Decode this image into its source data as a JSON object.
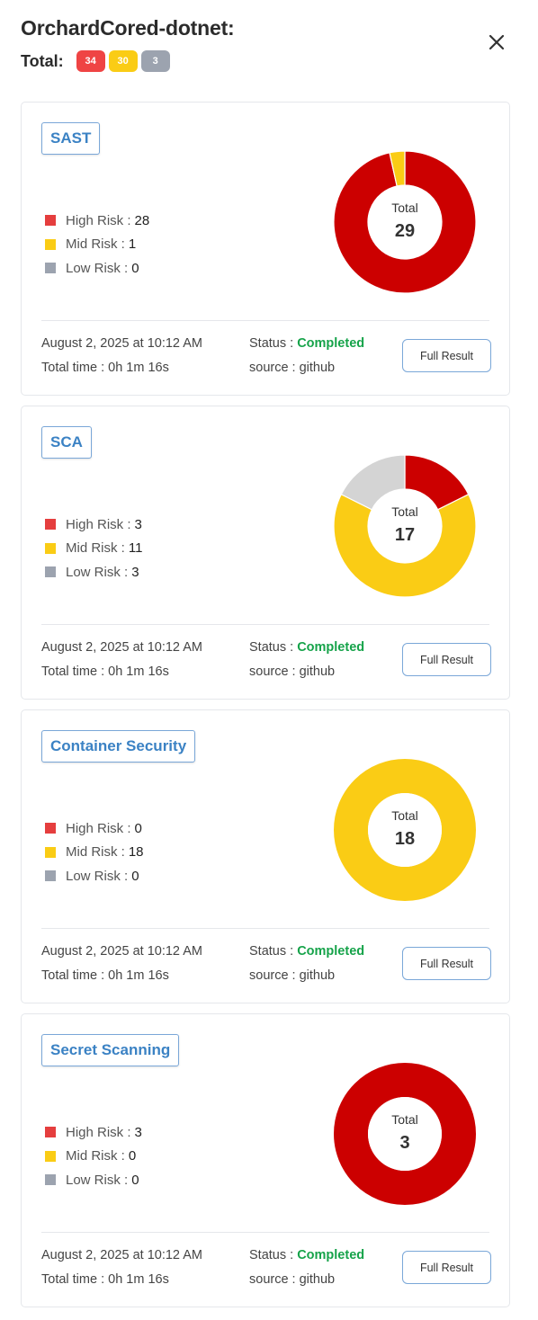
{
  "header": {
    "title": "OrchardCored-dotnet:",
    "total_label": "Total:",
    "badges": [
      {
        "value": "34",
        "color": "#ef4444"
      },
      {
        "value": "30",
        "color": "#facc15"
      },
      {
        "value": "3",
        "color": "#9ca3af"
      }
    ],
    "close_icon": "close-icon"
  },
  "colors": {
    "high": "#cc0000",
    "mid": "#facc15",
    "low": "#d4d4d4",
    "legend_high": "#e53e3e",
    "legend_mid": "#facc15",
    "legend_low": "#9ca3af",
    "status_completed": "#16a34a",
    "tag_text": "#3b82c4"
  },
  "cards": [
    {
      "title": "SAST",
      "legend": [
        {
          "label": "High Risk :",
          "value": "28"
        },
        {
          "label": "Mid Risk :",
          "value": "1"
        },
        {
          "label": "Low Risk :",
          "value": "0"
        }
      ],
      "donut": {
        "center_label": "Total",
        "total": "29",
        "high": 28,
        "mid": 1,
        "low": 0
      },
      "date": "August 2, 2025 at 10:12 AM",
      "total_time": "Total time : 0h 1m 16s",
      "status_label": "Status :",
      "status_value": "Completed",
      "source": "source : github",
      "button_label": "Full Result"
    },
    {
      "title": "SCA",
      "legend": [
        {
          "label": "High Risk :",
          "value": "3"
        },
        {
          "label": "Mid Risk :",
          "value": "11"
        },
        {
          "label": "Low Risk :",
          "value": "3"
        }
      ],
      "donut": {
        "center_label": "Total",
        "total": "17",
        "high": 3,
        "mid": 11,
        "low": 3
      },
      "date": "August 2, 2025 at 10:12 AM",
      "total_time": "Total time : 0h 1m 16s",
      "status_label": "Status :",
      "status_value": "Completed",
      "source": "source : github",
      "button_label": "Full Result"
    },
    {
      "title": "Container Security",
      "legend": [
        {
          "label": "High Risk :",
          "value": "0"
        },
        {
          "label": "Mid Risk :",
          "value": "18"
        },
        {
          "label": "Low Risk :",
          "value": "0"
        }
      ],
      "donut": {
        "center_label": "Total",
        "total": "18",
        "high": 0,
        "mid": 18,
        "low": 0
      },
      "date": "August 2, 2025 at 10:12 AM",
      "total_time": "Total time : 0h 1m 16s",
      "status_label": "Status :",
      "status_value": "Completed",
      "source": "source : github",
      "button_label": "Full Result"
    },
    {
      "title": "Secret Scanning",
      "legend": [
        {
          "label": "High Risk :",
          "value": "3"
        },
        {
          "label": "Mid Risk :",
          "value": "0"
        },
        {
          "label": "Low Risk :",
          "value": "0"
        }
      ],
      "donut": {
        "center_label": "Total",
        "total": "3",
        "high": 3,
        "mid": 0,
        "low": 0
      },
      "date": "August 2, 2025 at 10:12 AM",
      "total_time": "Total time : 0h 1m 16s",
      "status_label": "Status :",
      "status_value": "Completed",
      "source": "source : github",
      "button_label": "Full Result"
    }
  ]
}
